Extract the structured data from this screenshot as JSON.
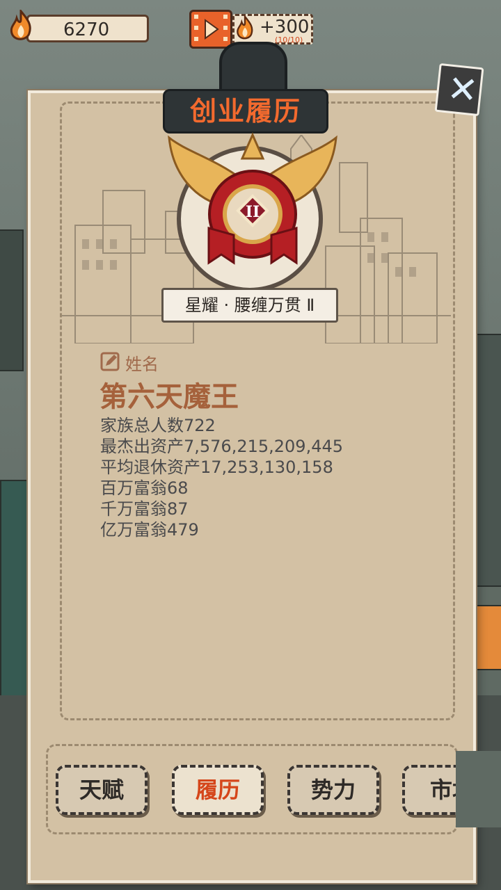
{
  "hud": {
    "coins": "6270",
    "reward_amount": "+300",
    "reward_uses": "(10/10)"
  },
  "panel": {
    "title": "创业履历",
    "rank_title": "星耀 · 腰缠万贯 Ⅱ",
    "badge_level": "II"
  },
  "profile": {
    "name_label": "姓名",
    "name": "第六天魔王",
    "stats": [
      "家族总人数722",
      "最杰出资产7,576,215,209,445",
      "平均退休资产17,253,130,158",
      "百万富翁68",
      "千万富翁87",
      "亿万富翁479"
    ]
  },
  "tabs": [
    "天赋",
    "履历",
    "势力",
    "市场"
  ],
  "active_tab": "履历",
  "colors": {
    "accent": "#f36a2e",
    "paper": "#d3c1a4",
    "title_plate": "#2e3436",
    "name_text": "#a5613b",
    "stat_text": "#4a4a4c"
  },
  "icons": [
    "flame-icon",
    "video-reward-icon",
    "close-icon",
    "edit-name-icon",
    "rank-badge-icon"
  ]
}
